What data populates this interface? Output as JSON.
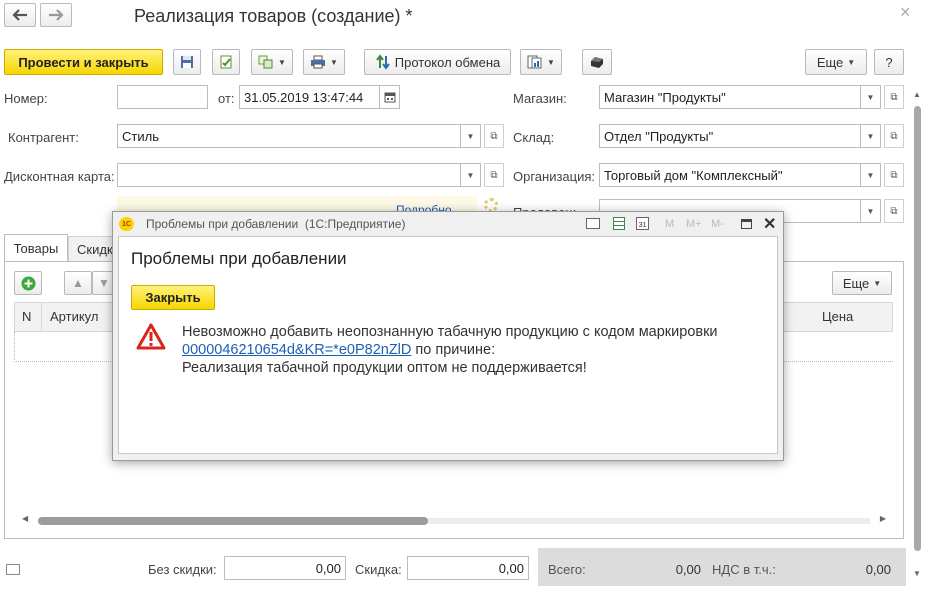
{
  "window": {
    "title": "Реализация товаров (создание) *",
    "back_icon": "arrow-left-icon",
    "forward_icon": "arrow-right-icon",
    "close_glyph": "×"
  },
  "toolbar": {
    "post_and_close": "Провести и закрыть",
    "exchange_log": "Протокол обмена",
    "more": "Еще",
    "help": "?"
  },
  "form": {
    "number_label": "Номер:",
    "number_value": "",
    "date_label": "от:",
    "date_value": "31.05.2019 13:47:44",
    "counterparty_label": "Контрагент:",
    "counterparty_value": "Стиль",
    "discount_card_label": "Дисконтная карта:",
    "discount_card_value": "",
    "store_label": "Магазин:",
    "store_value": "Магазин \"Продукты\"",
    "warehouse_label": "Склад:",
    "warehouse_value": "Отдел \"Продукты\"",
    "organization_label": "Организация:",
    "organization_value": "Торговый дом \"Комплексный\"",
    "seller_label": "Продавец:",
    "details_link": "Подробно"
  },
  "tabs": [
    {
      "label": "Товары"
    },
    {
      "label": "Скидки"
    }
  ],
  "table": {
    "more": "Еще",
    "columns": {
      "n": "N",
      "article": "Артикул",
      "price": "Цена"
    }
  },
  "footer": {
    "no_discount_label": "Без скидки:",
    "no_discount_value": "0,00",
    "discount_label": "Скидка:",
    "discount_value": "0,00",
    "total_label": "Всего:",
    "total_value": "0,00",
    "vat_label": "НДС в т.ч.:",
    "vat_value": "0,00"
  },
  "dialog": {
    "titlebar": "Проблемы при добавлении  (1С:Предприятие)",
    "logo": "1С",
    "heading": "Проблемы при добавлении",
    "close_button": "Закрыть",
    "msg_line1": "Невозможно добавить неопознанную табачную продукцию с кодом маркировки",
    "msg_link": "0000046210654d&KR=*e0P82nZlD",
    "msg_line2_rest": " по причине:",
    "msg_line3": "Реализация табачной продукции оптом не поддерживается!",
    "tool_m": "M",
    "tool_mplus": "M+",
    "tool_mminus": "M-",
    "colors": {
      "warning_red": "#d9261c",
      "link_blue": "#1b5fb3"
    }
  }
}
